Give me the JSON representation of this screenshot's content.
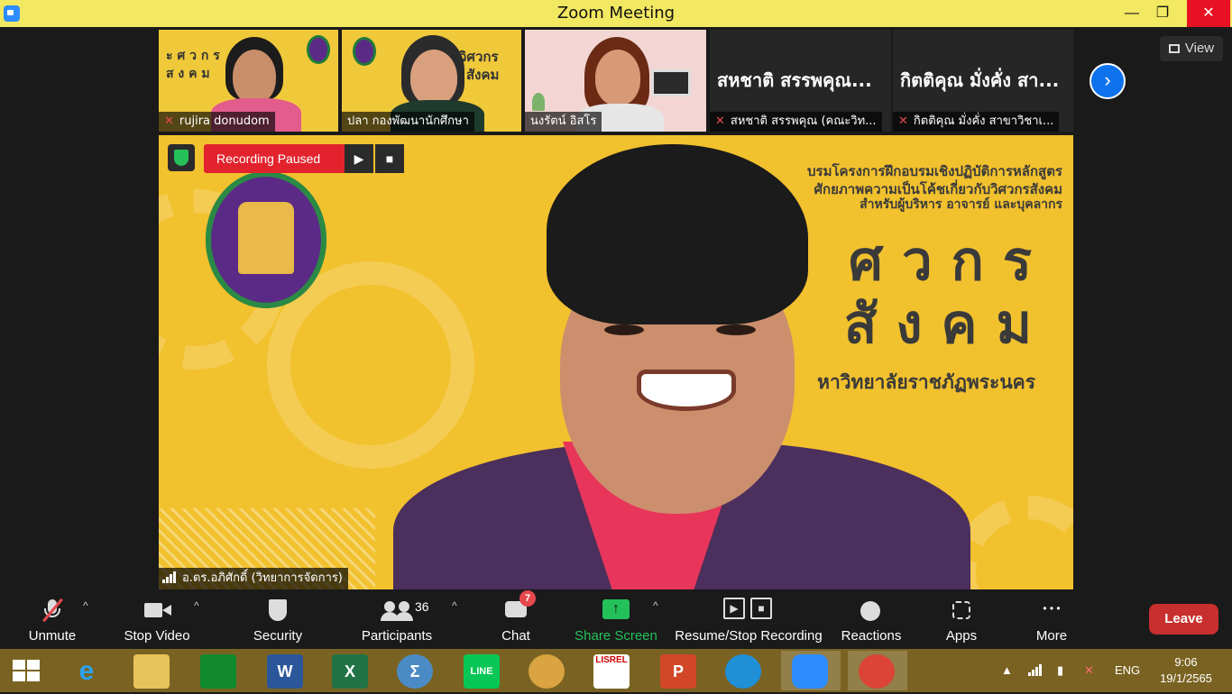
{
  "window": {
    "title": "Zoom Meeting",
    "minimize": "—",
    "maximize": "❐",
    "close": "✕"
  },
  "view_button": {
    "label": "View"
  },
  "gallery": [
    {
      "name": "rujira donudom"
    },
    {
      "name": "ปลา กองพัฒนานักศึกษา"
    },
    {
      "name": "นงรัตน์ อิสโร"
    },
    {
      "display": "สหชาติ สรรพคุณ...",
      "name": "สหชาติ สรรพคุณ (คณะวิท..."
    },
    {
      "display": "กิตติคุณ  มั่งคั่ง สา...",
      "name": "กิตติคุณ  มั่งคั่ง สาขาวิชาเ..."
    }
  ],
  "tile_slide_text": {
    "t1a": "ะ ศ ว ก ร",
    "t1b": "ส ง ค ม",
    "t2a": "วิศวกร",
    "t2b": "สังคม"
  },
  "next_arrow": "›",
  "recording": {
    "status": "Recording Paused",
    "play": "▶",
    "stop": "■"
  },
  "speaker": {
    "name": "อ.ดร.อภิศักดิ์ (วิทยาการจัดการ)",
    "slide_line1": "บรมโครงการฝึกอบรมเชิงปฏิบัติการหลักสูตร",
    "slide_line2": "ศักยภาพความเป็นโค้ชเกี่ยวกับวิศวกรสังคม",
    "slide_line3": "สำหรับผู้บริหาร อาจารย์ และบุคลากร",
    "slide_big1": "ศ ว ก ร",
    "slide_big2": "สั ง ค ม",
    "slide_footer": "หาวิทยาลัยราชภัฏพระนคร"
  },
  "toolbar": {
    "unmute": "Unmute",
    "stop_video": "Stop Video",
    "security": "Security",
    "participants": "Participants",
    "participant_count": "36",
    "chat": "Chat",
    "chat_badge": "7",
    "share_screen": "Share Screen",
    "share_arrow": "↑",
    "recording": "Resume/Stop Recording",
    "rec_play": "▶",
    "rec_stop": "■",
    "reactions": "Reactions",
    "apps": "Apps",
    "more": "More",
    "more_dots": "• • •",
    "caret": "^",
    "leave": "Leave"
  },
  "taskbar": {
    "icons": [
      "internet-explorer",
      "file-explorer",
      "store",
      "word",
      "excel",
      "math",
      "line",
      "paint",
      "lisrel",
      "powerpoint",
      "edge",
      "zoom",
      "chrome"
    ],
    "word_letter": "W",
    "excel_letter": "X",
    "ppt_letter": "P",
    "line_text": "LINE",
    "lisrel_text": "LISREL",
    "tray_arrow": "▲",
    "language": "ENG",
    "time": "9:06",
    "date": "19/1/2565"
  }
}
